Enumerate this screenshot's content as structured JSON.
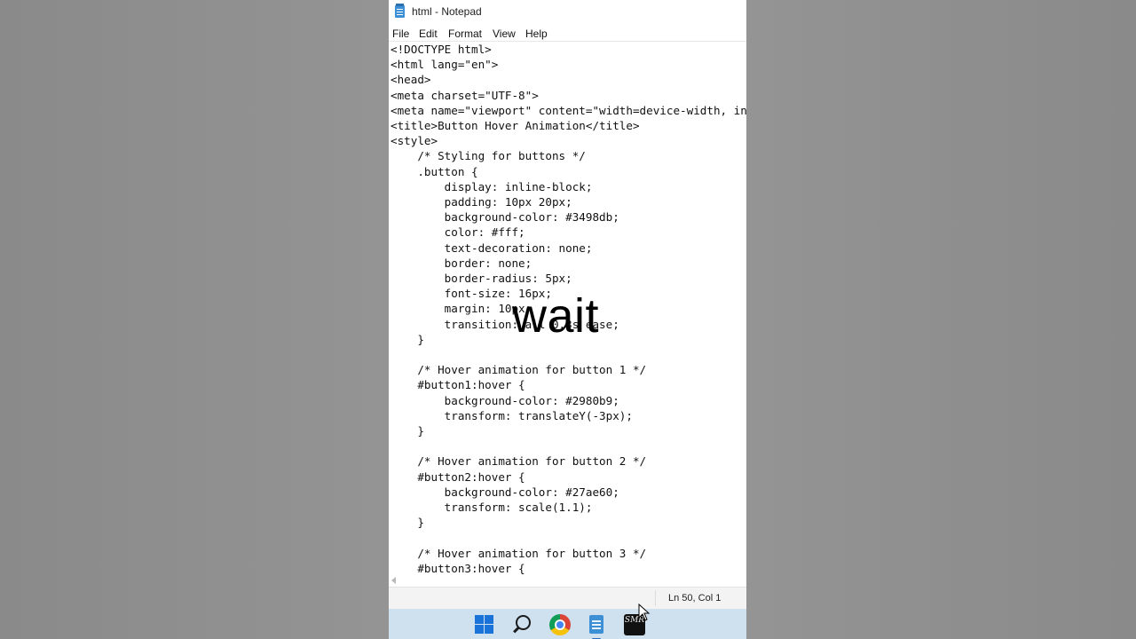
{
  "window": {
    "title": "html - Notepad",
    "icon": "notepad-icon"
  },
  "menu": [
    "File",
    "Edit",
    "Format",
    "View",
    "Help"
  ],
  "editor": {
    "lines": [
      "<!DOCTYPE html>",
      "<html lang=\"en\">",
      "<head>",
      "<meta charset=\"UTF-8\">",
      "<meta name=\"viewport\" content=\"width=device-width, in",
      "<title>Button Hover Animation</title>",
      "<style>",
      "    /* Styling for buttons */",
      "    .button {",
      "        display: inline-block;",
      "        padding: 10px 20px;",
      "        background-color: #3498db;",
      "        color: #fff;",
      "        text-decoration: none;",
      "        border: none;",
      "        border-radius: 5px;",
      "        font-size: 16px;",
      "        margin: 10px;",
      "        transition: all 0.3s ease;",
      "    }",
      "",
      "    /* Hover animation for button 1 */",
      "    #button1:hover {",
      "        background-color: #2980b9;",
      "        transform: translateY(-3px);",
      "    }",
      "",
      "    /* Hover animation for button 2 */",
      "    #button2:hover {",
      "        background-color: #27ae60;",
      "        transform: scale(1.1);",
      "    }",
      "",
      "    /* Hover animation for button 3 */",
      "    #button3:hover {"
    ]
  },
  "statusbar": {
    "position": "Ln 50, Col 1"
  },
  "taskbar": {
    "items": [
      "start-icon",
      "search-icon",
      "chrome-icon",
      "notepad-icon",
      "app-icon"
    ],
    "app_icon_text": "SMR"
  },
  "overlay": {
    "text": "wait"
  }
}
